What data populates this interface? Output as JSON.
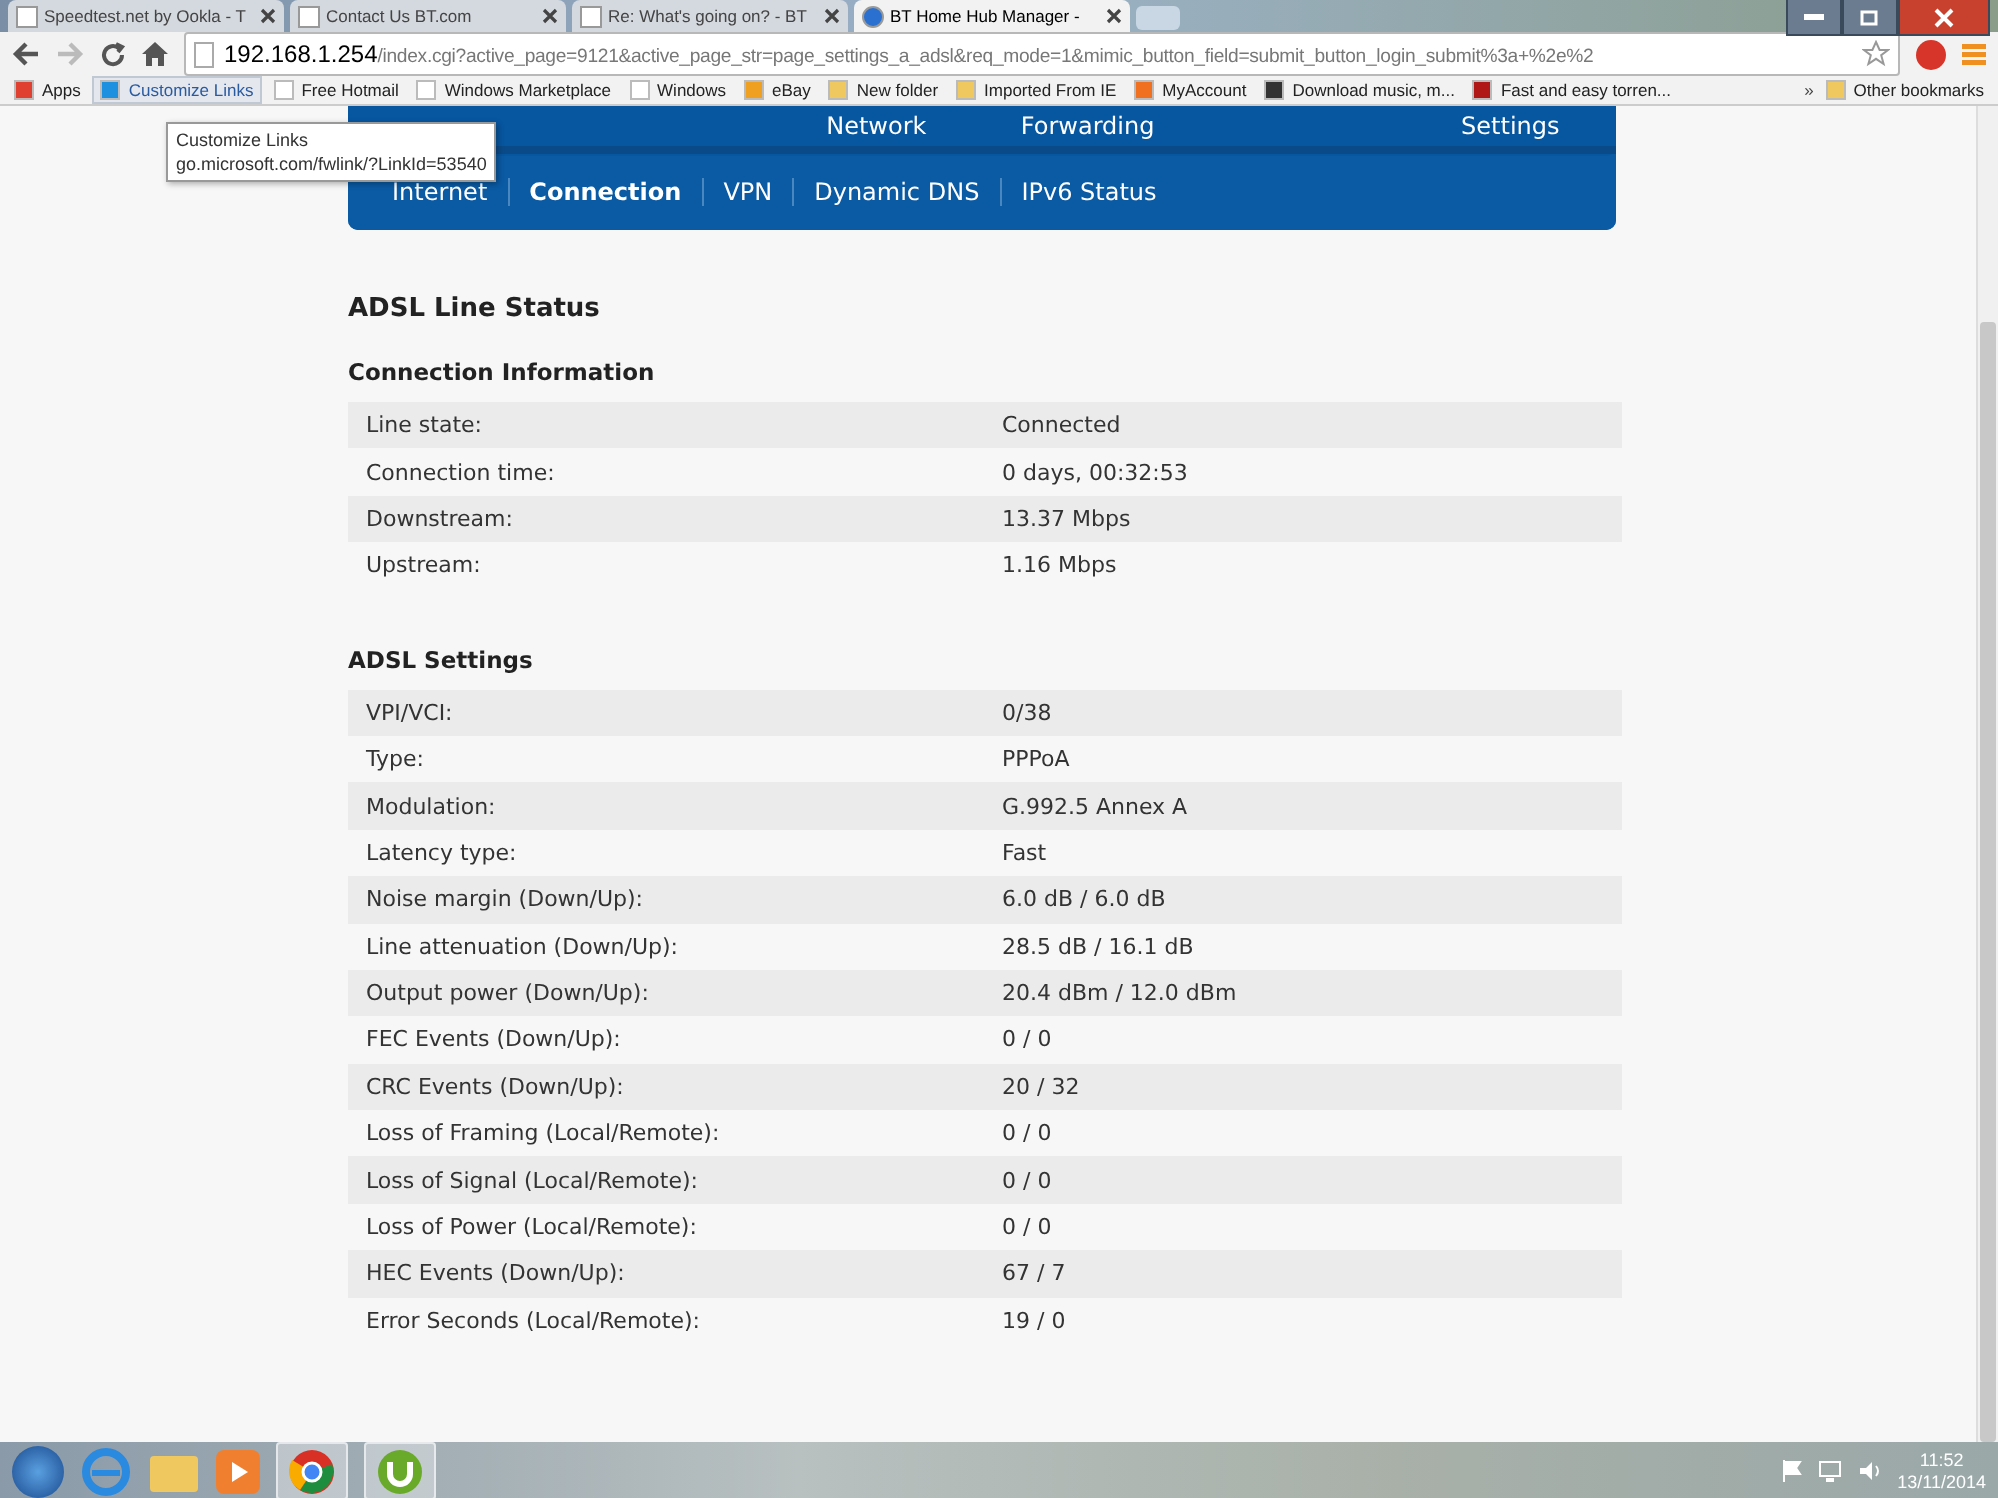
{
  "browser": {
    "tabs": [
      {
        "title": "Speedtest.net by Ookla - T",
        "selected": false
      },
      {
        "title": "Contact Us BT.com",
        "selected": false
      },
      {
        "title": "Re: What's going on? - BT",
        "selected": false
      },
      {
        "title": "BT Home Hub Manager -",
        "selected": true
      }
    ],
    "address": {
      "host": "192.168.1.254",
      "path": "/index.cgi?active_page=9121&active_page_str=page_settings_a_adsl&req_mode=1&mimic_button_field=submit_button_login_submit%3a+%2e%2"
    },
    "bookmarks": [
      {
        "label": "Apps",
        "kind": "apps"
      },
      {
        "label": "Customize Links",
        "kind": "windows"
      },
      {
        "label": "Free Hotmail",
        "kind": "page"
      },
      {
        "label": "Windows Marketplace",
        "kind": "page"
      },
      {
        "label": "Windows",
        "kind": "page"
      },
      {
        "label": "eBay",
        "kind": "bag"
      },
      {
        "label": "New folder",
        "kind": "folder"
      },
      {
        "label": "Imported From IE",
        "kind": "folder"
      },
      {
        "label": "MyAccount",
        "kind": "star"
      },
      {
        "label": "Download music, m...",
        "kind": "printer"
      },
      {
        "label": "Fast and easy torren...",
        "kind": "red"
      }
    ],
    "overflow": "»",
    "other_bookmarks": "Other bookmarks",
    "tooltip": {
      "title": "Customize Links",
      "url": "go.microsoft.com/fwlink/?LinkId=53540"
    }
  },
  "nav": {
    "top_items": [
      "Network",
      "Forwarding",
      "Settings"
    ],
    "sub_items": [
      {
        "label": "Internet",
        "selected": false
      },
      {
        "label": "Connection",
        "selected": true
      },
      {
        "label": "VPN",
        "selected": false
      },
      {
        "label": "Dynamic DNS",
        "selected": false
      },
      {
        "label": "IPv6 Status",
        "selected": false
      }
    ]
  },
  "page_title": "ADSL Line Status",
  "sections": [
    {
      "title": "Connection Information",
      "rows": [
        {
          "label": "Line state:",
          "value": "Connected"
        },
        {
          "label": "Connection time:",
          "value": "0 days, 00:32:53"
        },
        {
          "label": "Downstream:",
          "value": "13.37 Mbps"
        },
        {
          "label": "Upstream:",
          "value": "1.16 Mbps"
        }
      ]
    },
    {
      "title": "ADSL Settings",
      "rows": [
        {
          "label": "VPI/VCI:",
          "value": "0/38"
        },
        {
          "label": "Type:",
          "value": "PPPoA"
        },
        {
          "label": "Modulation:",
          "value": "G.992.5 Annex A"
        },
        {
          "label": "Latency type:",
          "value": "Fast"
        },
        {
          "label": "Noise margin (Down/Up):",
          "value": "6.0 dB / 6.0 dB"
        },
        {
          "label": "Line attenuation (Down/Up):",
          "value": "28.5 dB / 16.1 dB"
        },
        {
          "label": "Output power (Down/Up):",
          "value": "20.4 dBm / 12.0 dBm"
        },
        {
          "label": "FEC Events (Down/Up):",
          "value": "0 / 0"
        },
        {
          "label": "CRC Events (Down/Up):",
          "value": "20 / 32"
        },
        {
          "label": "Loss of Framing (Local/Remote):",
          "value": "0 / 0"
        },
        {
          "label": "Loss of Signal (Local/Remote):",
          "value": "0 / 0"
        },
        {
          "label": "Loss of Power (Local/Remote):",
          "value": "0 / 0"
        },
        {
          "label": "HEC Events (Down/Up):",
          "value": "67 / 7"
        },
        {
          "label": "Error Seconds (Local/Remote):",
          "value": "19 / 0"
        }
      ]
    }
  ],
  "taskbar": {
    "time": "11:52",
    "date": "13/11/2014"
  }
}
